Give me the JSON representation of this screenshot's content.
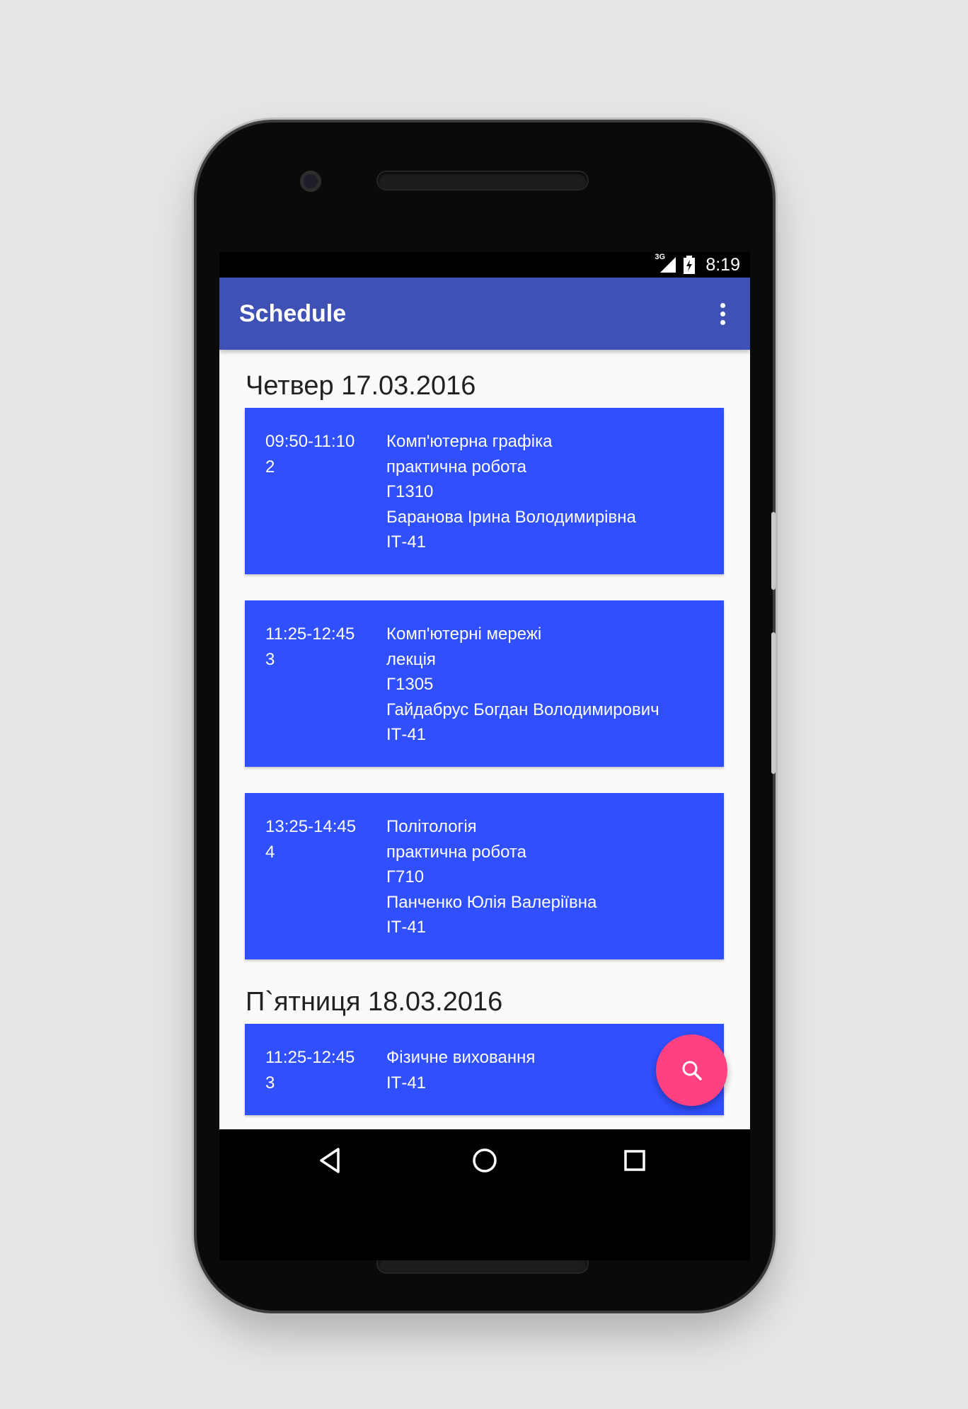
{
  "status_bar": {
    "network": "3G",
    "time": "8:19"
  },
  "app_bar": {
    "title": "Schedule",
    "overflow_icon": "more-vert-icon"
  },
  "days": [
    {
      "header": "Четвер 17.03.2016",
      "lessons": [
        {
          "time": "09:50-11:10",
          "number": "2",
          "subject": "Комп'ютерна графіка",
          "type": "практична робота",
          "room": "Г1310",
          "teacher": "Баранова Ірина Володимирівна",
          "group": "ІТ-41"
        },
        {
          "time": "11:25-12:45",
          "number": "3",
          "subject": "Комп'ютерні мережі",
          "type": "лекція",
          "room": "Г1305",
          "teacher": "Гайдабрус Богдан Володимирович",
          "group": "ІТ-41"
        },
        {
          "time": "13:25-14:45",
          "number": "4",
          "subject": "Політологія",
          "type": "практична робота",
          "room": "Г710",
          "teacher": "Панченко Юлія Валеріївна",
          "group": "ІТ-41"
        }
      ]
    },
    {
      "header": "П`ятниця 18.03.2016",
      "lessons": [
        {
          "time": "11:25-12:45",
          "number": "3",
          "subject": "Фізичне виховання",
          "group": "ІТ-41"
        }
      ]
    }
  ],
  "fab": {
    "icon": "search-icon"
  },
  "nav_bar": {
    "back_icon": "back-icon",
    "home_icon": "home-icon",
    "recents_icon": "recents-icon"
  },
  "colors": {
    "app_bar": "#3f51b5",
    "card": "#304ffe",
    "fab": "#ff4081",
    "background": "#fafafa"
  }
}
